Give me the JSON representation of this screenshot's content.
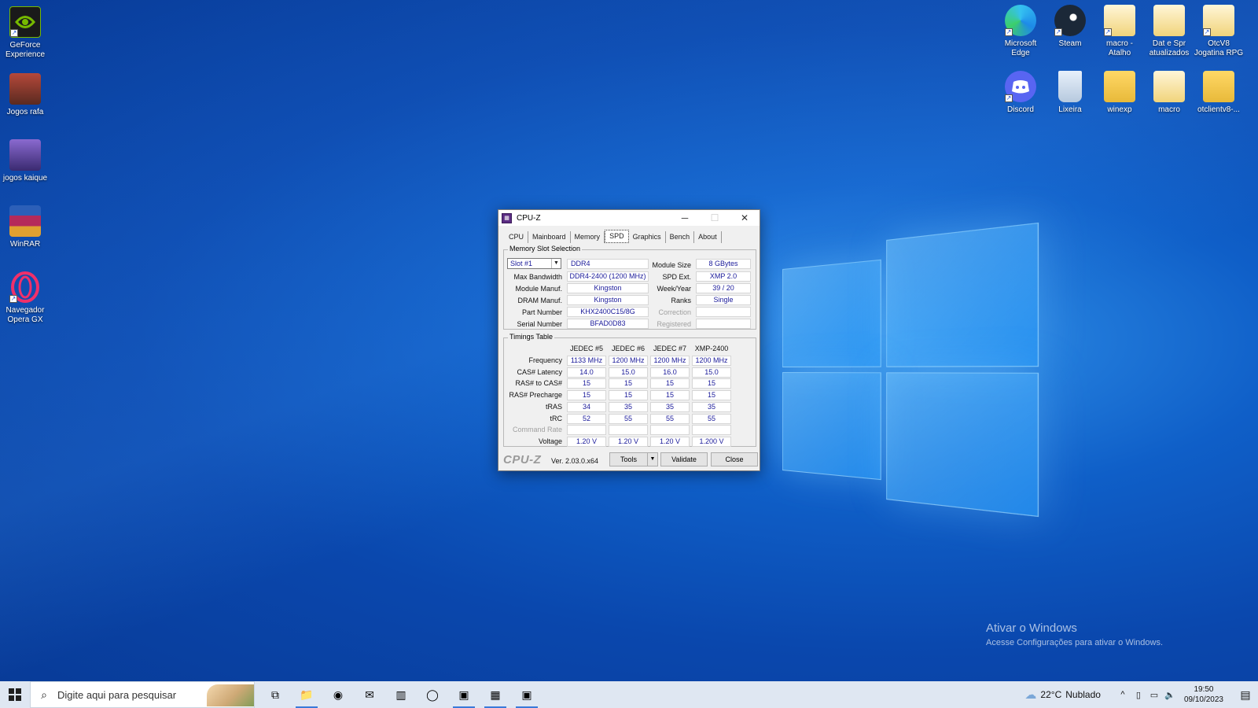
{
  "desktop": {
    "left_icons": [
      {
        "label": "GeForce Experience",
        "icon": "geforce-icon",
        "color": "#1a1a1a"
      },
      {
        "label": "Jogos rafa",
        "icon": "game-archive-icon",
        "color": "#7a3b2a"
      },
      {
        "label": "jogos kaique",
        "icon": "game-archive-icon",
        "color": "#5a3a8a"
      },
      {
        "label": "WinRAR",
        "icon": "winrar-icon",
        "color": "#8a1f4a"
      },
      {
        "label": "Navegador Opera GX",
        "icon": "opera-gx-icon",
        "color": "#e0205a"
      }
    ],
    "right_icons_row1": [
      {
        "label": "Microsoft Edge",
        "icon": "edge-icon"
      },
      {
        "label": "Steam",
        "icon": "steam-icon"
      },
      {
        "label": "macro - Atalho",
        "icon": "folder-icon"
      },
      {
        "label": "Dat e Spr atualizados",
        "icon": "folder-icon"
      },
      {
        "label": "OtcV8 Jogatina RPG",
        "icon": "folder-icon"
      }
    ],
    "right_icons_row2": [
      {
        "label": "Discord",
        "icon": "discord-icon"
      },
      {
        "label": "Lixeira",
        "icon": "recycle-bin-icon"
      },
      {
        "label": "winexp",
        "icon": "folder-icon"
      },
      {
        "label": "macro",
        "icon": "folder-icon"
      },
      {
        "label": "otclientv8-...",
        "icon": "folder-icon"
      }
    ]
  },
  "cpuz": {
    "title": "CPU-Z",
    "tabs": [
      "CPU",
      "Mainboard",
      "Memory",
      "SPD",
      "Graphics",
      "Bench",
      "About"
    ],
    "active_tab": "SPD",
    "slot_group_title": "Memory Slot Selection",
    "slot_selected": "Slot #1",
    "memory_type": "DDR4",
    "labels": {
      "max_bandwidth": "Max Bandwidth",
      "module_manuf": "Module Manuf.",
      "dram_manuf": "DRAM Manuf.",
      "part_number": "Part Number",
      "serial_number": "Serial Number",
      "module_size": "Module Size",
      "spd_ext": "SPD Ext.",
      "week_year": "Week/Year",
      "ranks": "Ranks",
      "correction": "Correction",
      "registered": "Registered"
    },
    "values": {
      "max_bandwidth": "DDR4-2400 (1200 MHz)",
      "module_manuf": "Kingston",
      "dram_manuf": "Kingston",
      "part_number": "KHX2400C15/8G",
      "serial_number": "BFAD0D83",
      "module_size": "8 GBytes",
      "spd_ext": "XMP 2.0",
      "week_year": "39 / 20",
      "ranks": "Single",
      "correction": "",
      "registered": ""
    },
    "timings_title": "Timings Table",
    "timing_columns": [
      "JEDEC #5",
      "JEDEC #6",
      "JEDEC #7",
      "XMP-2400"
    ],
    "timing_rows": [
      {
        "label": "Frequency",
        "values": [
          "1133 MHz",
          "1200 MHz",
          "1200 MHz",
          "1200 MHz"
        ]
      },
      {
        "label": "CAS# Latency",
        "values": [
          "14.0",
          "15.0",
          "16.0",
          "15.0"
        ]
      },
      {
        "label": "RAS# to CAS#",
        "values": [
          "15",
          "15",
          "15",
          "15"
        ]
      },
      {
        "label": "RAS# Precharge",
        "values": [
          "15",
          "15",
          "15",
          "15"
        ]
      },
      {
        "label": "tRAS",
        "values": [
          "34",
          "35",
          "35",
          "35"
        ]
      },
      {
        "label": "tRC",
        "values": [
          "52",
          "55",
          "55",
          "55"
        ]
      },
      {
        "label": "Command Rate",
        "values": [
          "",
          "",
          "",
          ""
        ],
        "dim": true
      },
      {
        "label": "Voltage",
        "values": [
          "1.20 V",
          "1.20 V",
          "1.20 V",
          "1.200 V"
        ]
      }
    ],
    "footer": {
      "brand": "CPU-Z",
      "version": "Ver. 2.03.0.x64",
      "tools": "Tools",
      "validate": "Validate",
      "close": "Close"
    }
  },
  "watermark": {
    "line1": "Ativar o Windows",
    "line2": "Acesse Configurações para ativar o Windows."
  },
  "taskbar": {
    "search_placeholder": "Digite aqui para pesquisar",
    "apps": [
      {
        "icon": "task-view-icon",
        "glyph": "⧉",
        "active": false
      },
      {
        "icon": "file-explorer-icon",
        "glyph": "📁",
        "active": true
      },
      {
        "icon": "edge-icon",
        "glyph": "◉",
        "active": false
      },
      {
        "icon": "mail-icon",
        "glyph": "✉",
        "active": false
      },
      {
        "icon": "app-bars-icon",
        "glyph": "▥",
        "active": false
      },
      {
        "icon": "opera-gx-icon",
        "glyph": "◯",
        "active": false
      },
      {
        "icon": "geforce-icon",
        "glyph": "▣",
        "active": true
      },
      {
        "icon": "cpuz-icon",
        "glyph": "▦",
        "active": true
      },
      {
        "icon": "nvidia-icon",
        "glyph": "▣",
        "active": true
      }
    ],
    "weather_temp": "22°C",
    "weather_desc": "Nublado",
    "time": "19:50",
    "date": "09/10/2023"
  }
}
